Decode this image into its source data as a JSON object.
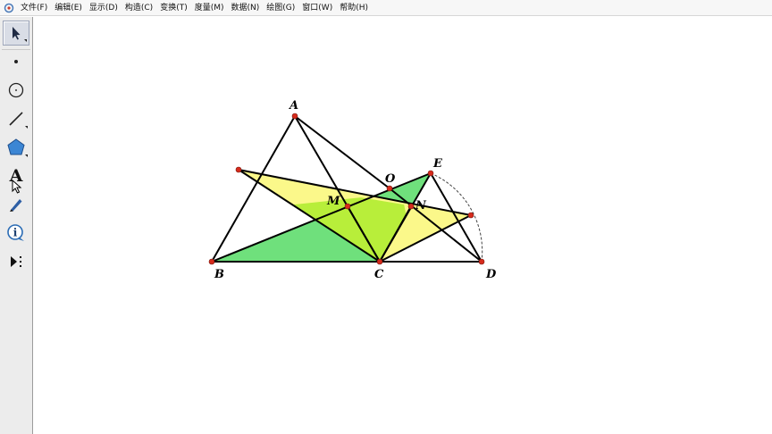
{
  "menu": [
    {
      "label": "文件(F)"
    },
    {
      "label": "编辑(E)"
    },
    {
      "label": "显示(D)"
    },
    {
      "label": "构造(C)"
    },
    {
      "label": "变换(T)"
    },
    {
      "label": "度量(M)"
    },
    {
      "label": "数据(N)"
    },
    {
      "label": "绘图(G)"
    },
    {
      "label": "窗口(W)"
    },
    {
      "label": "帮助(H)"
    }
  ],
  "toolbox": [
    {
      "name": "arrow-select-tool-icon",
      "active": true
    },
    {
      "name": "point-tool-icon"
    },
    {
      "name": "compass-tool-icon"
    },
    {
      "name": "straightedge-tool-icon"
    },
    {
      "name": "polygon-tool-icon"
    },
    {
      "name": "text-tool-icon",
      "glyph": "A"
    },
    {
      "name": "marker-tool-icon"
    },
    {
      "name": "information-tool-icon",
      "glyph": "i"
    },
    {
      "name": "custom-tool-icon"
    }
  ],
  "figure": {
    "labels": {
      "A": "A",
      "B": "B",
      "C": "C",
      "D": "D",
      "E": "E",
      "O": "O",
      "M": "M",
      "N": "N"
    },
    "colors": {
      "green": "#6fe07c",
      "yellow": "#fbf88a",
      "overlap": "#b8ee3a",
      "point": "#d62b1c",
      "line": "#000000"
    }
  }
}
